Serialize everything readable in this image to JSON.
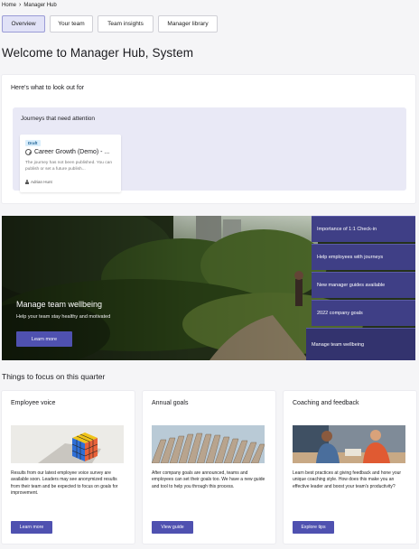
{
  "breadcrumb": {
    "home": "Home",
    "current": "Manager Hub"
  },
  "tabs": [
    {
      "label": "Overview",
      "active": true
    },
    {
      "label": "Your team",
      "active": false
    },
    {
      "label": "Team insights",
      "active": false
    },
    {
      "label": "Manager library",
      "active": false
    }
  ],
  "page_title": "Welcome to Manager Hub, System",
  "watch": {
    "title": "Here's what to look out for",
    "journeys_title": "Journeys that need attention",
    "journey": {
      "badge": "Draft",
      "icon": "journey-icon",
      "name": "Career Growth (Demo) - ...",
      "description": "The journey has not been published. You can publish or set a future publish...",
      "author": "Adrian Hunt"
    }
  },
  "hero": {
    "title": "Manage team wellbeing",
    "subtitle": "Help your team stay healthy and motivated",
    "button": "Learn more",
    "menu": [
      "Importance of 1:1 Check-in",
      "Help employees with journeys",
      "New manager guides available",
      "2022 company goals",
      "Manage team wellbeing"
    ],
    "active_menu_index": 4
  },
  "focus": {
    "title": "Things to focus on this quarter",
    "cards": [
      {
        "title": "Employee voice",
        "image": "rubiks-cube-image",
        "text": "Results from our latest employee voice survey are available soon. Leaders may see anonymized results from their team and be expected to focus on goals for improvement.",
        "button": "Learn more"
      },
      {
        "title": "Annual goals",
        "image": "building-facade-image",
        "text": "After company goals are announced, teams and employees can set their goals too. We have a new guide and tool to help you through this process.",
        "button": "View guide"
      },
      {
        "title": "Coaching and feedback",
        "image": "people-meeting-image",
        "text": "Learn best practices at giving feedback and hone your unique coaching style. How does this make you an effective leader and boost your team's productivity?",
        "button": "Explore tips"
      }
    ]
  },
  "colors": {
    "accent": "#4f51b0",
    "tab_active": "#e1e2f7",
    "panel": "#e9e9f6",
    "hero_menu": "#3f3f86"
  }
}
